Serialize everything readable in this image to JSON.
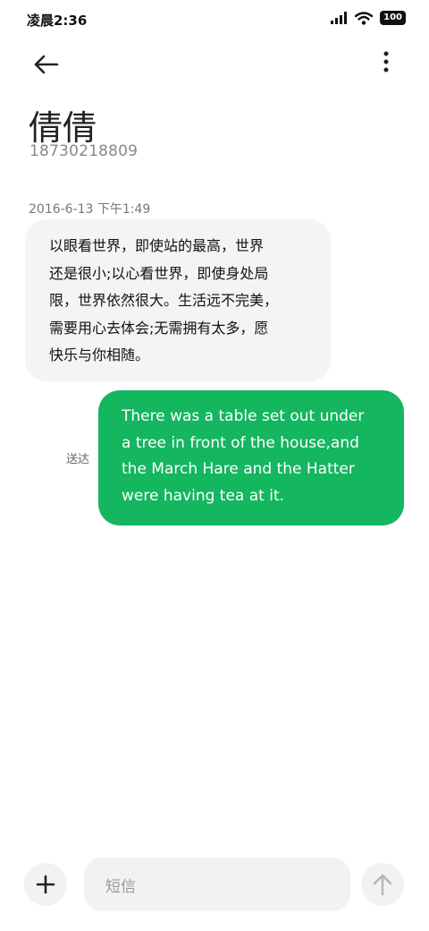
{
  "status_bar": {
    "time": "凌晨2:36",
    "battery": "100",
    "icons": [
      "signal-icon",
      "wifi-icon",
      "battery-icon"
    ]
  },
  "header": {
    "back_icon": "back-arrow-icon",
    "more_icon": "more-vertical-icon",
    "contact_name": "倩倩",
    "contact_number": "18730218809"
  },
  "conversation": {
    "timestamp": "2016-6-13 下午1:49",
    "incoming": {
      "lines": [
        "以眼看世界，即使站的最高，世界",
        "还是很小;以心看世界，即使身处局",
        "限，世界依然很大。生活远不完美，",
        "需要用心去体会;无需拥有太多，愿",
        "快乐与你相随。"
      ]
    },
    "outgoing": {
      "lines": [
        "There was a table set out under",
        "a tree in front of the house,and",
        "the March Hare and the Hatter",
        "were having tea at it."
      ],
      "status": "送达"
    }
  },
  "composer": {
    "add_icon": "plus-icon",
    "placeholder": "短信",
    "send_icon": "arrow-up-icon"
  },
  "colors": {
    "outgoing_bubble": "#14b660",
    "incoming_bubble": "#f4f4f4",
    "composer_bg": "#f2f2f2"
  }
}
